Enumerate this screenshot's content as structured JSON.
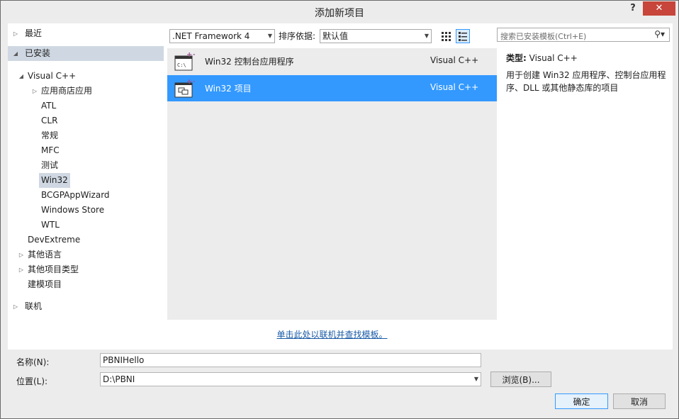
{
  "window": {
    "title": "添加新项目",
    "help_label": "?",
    "close_label": "✕"
  },
  "tree": {
    "items": [
      {
        "label": "最近",
        "arrow": "▷"
      },
      {
        "label": "已安装",
        "arrow": "◢"
      },
      {
        "label": "Visual C++",
        "arrow": "◢"
      },
      {
        "label": "应用商店应用",
        "arrow": "▷"
      },
      {
        "label": "ATL",
        "arrow": ""
      },
      {
        "label": "CLR",
        "arrow": ""
      },
      {
        "label": "常规",
        "arrow": ""
      },
      {
        "label": "MFC",
        "arrow": ""
      },
      {
        "label": "测试",
        "arrow": ""
      },
      {
        "label": "Win32",
        "arrow": ""
      },
      {
        "label": "BCGPAppWizard",
        "arrow": ""
      },
      {
        "label": "Windows Store",
        "arrow": ""
      },
      {
        "label": "WTL",
        "arrow": ""
      },
      {
        "label": "DevExtreme",
        "arrow": ""
      },
      {
        "label": "其他语言",
        "arrow": "▷"
      },
      {
        "label": "其他项目类型",
        "arrow": "▷"
      },
      {
        "label": "建模项目",
        "arrow": ""
      },
      {
        "label": "联机",
        "arrow": "▷"
      }
    ]
  },
  "toolbar": {
    "framework": ".NET Framework 4",
    "sort_label": "排序依据:",
    "sort_value": "默认值"
  },
  "templates": [
    {
      "name": "Win32 控制台应用程序",
      "lang": "Visual C++",
      "icon": "console-app-icon",
      "selected": false
    },
    {
      "name": "Win32 项目",
      "lang": "Visual C++",
      "icon": "win32-project-icon",
      "selected": true
    }
  ],
  "online_link": "单击此处以联机并查找模板。",
  "search": {
    "placeholder": "搜索已安装模板(Ctrl+E)"
  },
  "info": {
    "type_label": "类型:",
    "type_value": "Visual C++",
    "description": "用于创建 Win32 应用程序、控制台应用程序、DLL 或其他静态库的项目"
  },
  "form": {
    "name_label": "名称(N):",
    "name_value": "PBNIHello",
    "location_label": "位置(L):",
    "location_value": "D:\\PBNI",
    "browse_label": "浏览(B)...",
    "ok_label": "确定",
    "cancel_label": "取消"
  },
  "colors": {
    "selection": "#3399ff",
    "tree_highlight": "#cfd8e2",
    "close": "#c7453a",
    "link": "#1a5aa6"
  }
}
